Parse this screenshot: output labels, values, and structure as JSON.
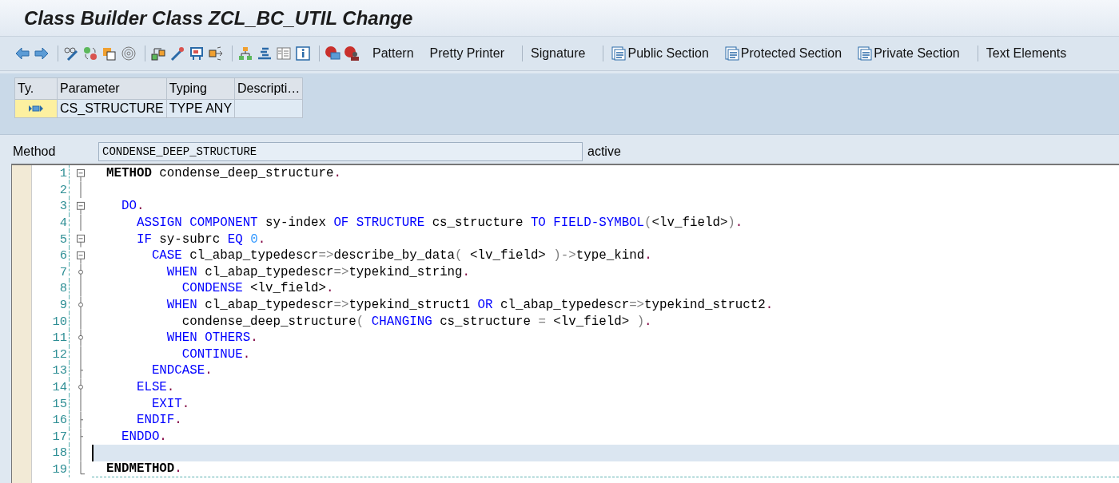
{
  "window": {
    "title": "Class Builder Class ZCL_BC_UTIL Change"
  },
  "toolbar": {
    "groups": [
      [
        {
          "label": "Pattern",
          "kind": "text"
        },
        {
          "label": "Pretty Printer",
          "kind": "text"
        }
      ],
      [
        {
          "label": "Signature",
          "kind": "text"
        }
      ],
      [
        {
          "label": "Public Section",
          "kind": "section"
        },
        {
          "label": "Protected Section",
          "kind": "section"
        },
        {
          "label": "Private Section",
          "kind": "section"
        }
      ],
      [
        {
          "label": "Text Elements",
          "kind": "text"
        }
      ]
    ]
  },
  "parameters": {
    "columns": [
      "Ty.",
      "Parameter",
      "Typing",
      "Descripti…"
    ],
    "rows": [
      {
        "cells": [
          "",
          "CS_STRUCTURE",
          "TYPE ANY",
          ""
        ]
      }
    ]
  },
  "method": {
    "label": "Method",
    "value": "CONDENSE_DEEP_STRUCTURE",
    "status": "active"
  },
  "code": {
    "lines": [
      {
        "number": "1",
        "kind": "open",
        "current": false,
        "tokens": [
          {
            "kind": "bold",
            "text": "METHOD"
          },
          {
            "kind": "ident",
            "text": " condense_deep_structure"
          },
          {
            "kind": "dot",
            "text": "."
          }
        ]
      },
      {
        "number": "2",
        "kind": "line",
        "current": false
      },
      {
        "number": "3",
        "kind": "open",
        "current": false,
        "tokens": [
          {
            "kind": "keyword",
            "text": "  DO"
          },
          {
            "kind": "dot",
            "text": "."
          }
        ]
      },
      {
        "number": "4",
        "kind": "line",
        "current": false,
        "tokens": [
          {
            "kind": "keyword",
            "text": "    ASSIGN COMPONENT"
          },
          {
            "kind": "ident",
            "text": " sy-index "
          },
          {
            "kind": "keyword",
            "text": "OF STRUCTURE"
          },
          {
            "kind": "ident",
            "text": " cs_structure "
          },
          {
            "kind": "keyword",
            "text": "TO FIELD-SYMBOL"
          },
          {
            "kind": "op",
            "text": "("
          },
          {
            "kind": "ident",
            "text": "<lv_field>"
          },
          {
            "kind": "op",
            "text": ")"
          },
          {
            "kind": "dot",
            "text": "."
          }
        ]
      },
      {
        "number": "5",
        "kind": "open",
        "current": false,
        "tokens": [
          {
            "kind": "keyword",
            "text": "    IF"
          },
          {
            "kind": "ident",
            "text": " sy-subrc "
          },
          {
            "kind": "keyword",
            "text": "EQ "
          },
          {
            "kind": "number",
            "text": "0"
          },
          {
            "kind": "dot",
            "text": "."
          }
        ]
      },
      {
        "number": "6",
        "kind": "open",
        "current": false,
        "tokens": [
          {
            "kind": "keyword",
            "text": "      CASE"
          },
          {
            "kind": "ident",
            "text": " cl_abap_typedescr"
          },
          {
            "kind": "op",
            "text": "=>"
          },
          {
            "kind": "ident",
            "text": "describe_by_data"
          },
          {
            "kind": "op",
            "text": "("
          },
          {
            "kind": "ident",
            "text": " <lv_field> "
          },
          {
            "kind": "op",
            "text": ")->"
          },
          {
            "kind": "ident",
            "text": "type_kind"
          },
          {
            "kind": "dot",
            "text": "."
          }
        ]
      },
      {
        "number": "7",
        "kind": "branch",
        "current": false,
        "tokens": [
          {
            "kind": "keyword",
            "text": "        WHEN"
          },
          {
            "kind": "ident",
            "text": " cl_abap_typedescr"
          },
          {
            "kind": "op",
            "text": "=>"
          },
          {
            "kind": "ident",
            "text": "typekind_string"
          },
          {
            "kind": "dot",
            "text": "."
          }
        ]
      },
      {
        "number": "8",
        "kind": "line",
        "current": false,
        "tokens": [
          {
            "kind": "keyword",
            "text": "          CONDENSE"
          },
          {
            "kind": "ident",
            "text": " <lv_field>"
          },
          {
            "kind": "dot",
            "text": "."
          }
        ]
      },
      {
        "number": "9",
        "kind": "branch",
        "current": false,
        "tokens": [
          {
            "kind": "keyword",
            "text": "        WHEN"
          },
          {
            "kind": "ident",
            "text": " cl_abap_typedescr"
          },
          {
            "kind": "op",
            "text": "=>"
          },
          {
            "kind": "ident",
            "text": "typekind_struct1 "
          },
          {
            "kind": "keyword",
            "text": "OR"
          },
          {
            "kind": "ident",
            "text": " cl_abap_typedescr"
          },
          {
            "kind": "op",
            "text": "=>"
          },
          {
            "kind": "ident",
            "text": "typekind_struct2"
          },
          {
            "kind": "dot",
            "text": "."
          }
        ]
      },
      {
        "number": "10",
        "kind": "line",
        "current": false,
        "tokens": [
          {
            "kind": "ident",
            "text": "          condense_deep_structure"
          },
          {
            "kind": "op",
            "text": "("
          },
          {
            "kind": "keyword",
            "text": " CHANGING"
          },
          {
            "kind": "ident",
            "text": " cs_structure "
          },
          {
            "kind": "op",
            "text": "="
          },
          {
            "kind": "ident",
            "text": " <lv_field> "
          },
          {
            "kind": "op",
            "text": ")"
          },
          {
            "kind": "dot",
            "text": "."
          }
        ]
      },
      {
        "number": "11",
        "kind": "branch",
        "current": false,
        "tokens": [
          {
            "kind": "keyword",
            "text": "        WHEN OTHERS"
          },
          {
            "kind": "dot",
            "text": "."
          }
        ]
      },
      {
        "number": "12",
        "kind": "line",
        "current": false,
        "tokens": [
          {
            "kind": "keyword",
            "text": "          CONTINUE"
          },
          {
            "kind": "dot",
            "text": "."
          }
        ]
      },
      {
        "number": "13",
        "kind": "end",
        "current": false,
        "tokens": [
          {
            "kind": "keyword",
            "text": "      ENDCASE"
          },
          {
            "kind": "dot",
            "text": "."
          }
        ]
      },
      {
        "number": "14",
        "kind": "branch",
        "current": false,
        "tokens": [
          {
            "kind": "keyword",
            "text": "    ELSE"
          },
          {
            "kind": "dot",
            "text": "."
          }
        ]
      },
      {
        "number": "15",
        "kind": "line",
        "current": false,
        "tokens": [
          {
            "kind": "keyword",
            "text": "      EXIT"
          },
          {
            "kind": "dot",
            "text": "."
          }
        ]
      },
      {
        "number": "16",
        "kind": "end",
        "current": false,
        "tokens": [
          {
            "kind": "keyword",
            "text": "    ENDIF"
          },
          {
            "kind": "dot",
            "text": "."
          }
        ]
      },
      {
        "number": "17",
        "kind": "end",
        "current": false,
        "tokens": [
          {
            "kind": "keyword",
            "text": "  ENDDO"
          },
          {
            "kind": "dot",
            "text": "."
          }
        ]
      },
      {
        "number": "18",
        "kind": "line",
        "current": true
      },
      {
        "number": "19",
        "kind": "last",
        "current": false,
        "tokens": [
          {
            "kind": "bold",
            "text": "ENDMETHOD"
          },
          {
            "kind": "dot",
            "text": "."
          }
        ]
      }
    ]
  }
}
